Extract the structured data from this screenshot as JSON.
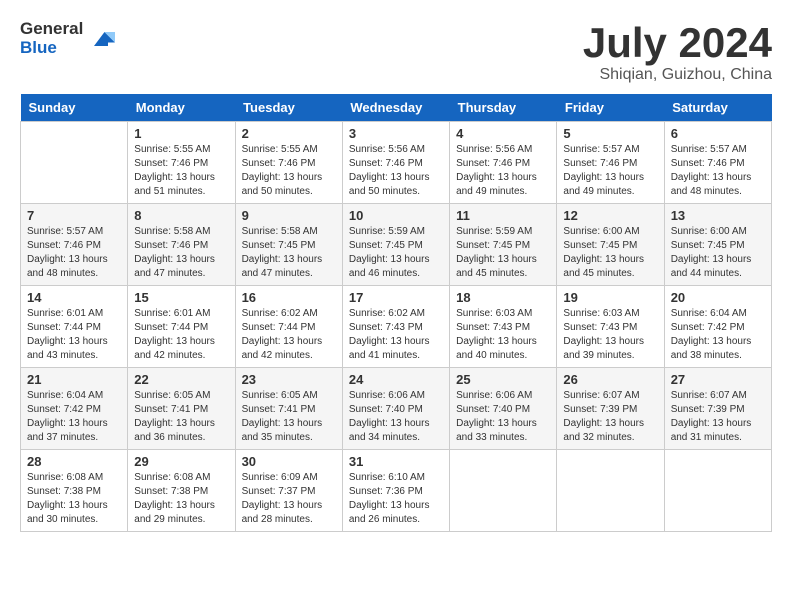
{
  "header": {
    "logo_general": "General",
    "logo_blue": "Blue",
    "month": "July 2024",
    "location": "Shiqian, Guizhou, China"
  },
  "days_of_week": [
    "Sunday",
    "Monday",
    "Tuesday",
    "Wednesday",
    "Thursday",
    "Friday",
    "Saturday"
  ],
  "weeks": [
    [
      {
        "day": "",
        "sunrise": "",
        "sunset": "",
        "daylight": ""
      },
      {
        "day": "1",
        "sunrise": "5:55 AM",
        "sunset": "7:46 PM",
        "daylight": "13 hours and 51 minutes."
      },
      {
        "day": "2",
        "sunrise": "5:55 AM",
        "sunset": "7:46 PM",
        "daylight": "13 hours and 50 minutes."
      },
      {
        "day": "3",
        "sunrise": "5:56 AM",
        "sunset": "7:46 PM",
        "daylight": "13 hours and 50 minutes."
      },
      {
        "day": "4",
        "sunrise": "5:56 AM",
        "sunset": "7:46 PM",
        "daylight": "13 hours and 49 minutes."
      },
      {
        "day": "5",
        "sunrise": "5:57 AM",
        "sunset": "7:46 PM",
        "daylight": "13 hours and 49 minutes."
      },
      {
        "day": "6",
        "sunrise": "5:57 AM",
        "sunset": "7:46 PM",
        "daylight": "13 hours and 48 minutes."
      }
    ],
    [
      {
        "day": "7",
        "sunrise": "5:57 AM",
        "sunset": "7:46 PM",
        "daylight": "13 hours and 48 minutes."
      },
      {
        "day": "8",
        "sunrise": "5:58 AM",
        "sunset": "7:46 PM",
        "daylight": "13 hours and 47 minutes."
      },
      {
        "day": "9",
        "sunrise": "5:58 AM",
        "sunset": "7:45 PM",
        "daylight": "13 hours and 47 minutes."
      },
      {
        "day": "10",
        "sunrise": "5:59 AM",
        "sunset": "7:45 PM",
        "daylight": "13 hours and 46 minutes."
      },
      {
        "day": "11",
        "sunrise": "5:59 AM",
        "sunset": "7:45 PM",
        "daylight": "13 hours and 45 minutes."
      },
      {
        "day": "12",
        "sunrise": "6:00 AM",
        "sunset": "7:45 PM",
        "daylight": "13 hours and 45 minutes."
      },
      {
        "day": "13",
        "sunrise": "6:00 AM",
        "sunset": "7:45 PM",
        "daylight": "13 hours and 44 minutes."
      }
    ],
    [
      {
        "day": "14",
        "sunrise": "6:01 AM",
        "sunset": "7:44 PM",
        "daylight": "13 hours and 43 minutes."
      },
      {
        "day": "15",
        "sunrise": "6:01 AM",
        "sunset": "7:44 PM",
        "daylight": "13 hours and 42 minutes."
      },
      {
        "day": "16",
        "sunrise": "6:02 AM",
        "sunset": "7:44 PM",
        "daylight": "13 hours and 42 minutes."
      },
      {
        "day": "17",
        "sunrise": "6:02 AM",
        "sunset": "7:43 PM",
        "daylight": "13 hours and 41 minutes."
      },
      {
        "day": "18",
        "sunrise": "6:03 AM",
        "sunset": "7:43 PM",
        "daylight": "13 hours and 40 minutes."
      },
      {
        "day": "19",
        "sunrise": "6:03 AM",
        "sunset": "7:43 PM",
        "daylight": "13 hours and 39 minutes."
      },
      {
        "day": "20",
        "sunrise": "6:04 AM",
        "sunset": "7:42 PM",
        "daylight": "13 hours and 38 minutes."
      }
    ],
    [
      {
        "day": "21",
        "sunrise": "6:04 AM",
        "sunset": "7:42 PM",
        "daylight": "13 hours and 37 minutes."
      },
      {
        "day": "22",
        "sunrise": "6:05 AM",
        "sunset": "7:41 PM",
        "daylight": "13 hours and 36 minutes."
      },
      {
        "day": "23",
        "sunrise": "6:05 AM",
        "sunset": "7:41 PM",
        "daylight": "13 hours and 35 minutes."
      },
      {
        "day": "24",
        "sunrise": "6:06 AM",
        "sunset": "7:40 PM",
        "daylight": "13 hours and 34 minutes."
      },
      {
        "day": "25",
        "sunrise": "6:06 AM",
        "sunset": "7:40 PM",
        "daylight": "13 hours and 33 minutes."
      },
      {
        "day": "26",
        "sunrise": "6:07 AM",
        "sunset": "7:39 PM",
        "daylight": "13 hours and 32 minutes."
      },
      {
        "day": "27",
        "sunrise": "6:07 AM",
        "sunset": "7:39 PM",
        "daylight": "13 hours and 31 minutes."
      }
    ],
    [
      {
        "day": "28",
        "sunrise": "6:08 AM",
        "sunset": "7:38 PM",
        "daylight": "13 hours and 30 minutes."
      },
      {
        "day": "29",
        "sunrise": "6:08 AM",
        "sunset": "7:38 PM",
        "daylight": "13 hours and 29 minutes."
      },
      {
        "day": "30",
        "sunrise": "6:09 AM",
        "sunset": "7:37 PM",
        "daylight": "13 hours and 28 minutes."
      },
      {
        "day": "31",
        "sunrise": "6:10 AM",
        "sunset": "7:36 PM",
        "daylight": "13 hours and 26 minutes."
      },
      {
        "day": "",
        "sunrise": "",
        "sunset": "",
        "daylight": ""
      },
      {
        "day": "",
        "sunrise": "",
        "sunset": "",
        "daylight": ""
      },
      {
        "day": "",
        "sunrise": "",
        "sunset": "",
        "daylight": ""
      }
    ]
  ]
}
